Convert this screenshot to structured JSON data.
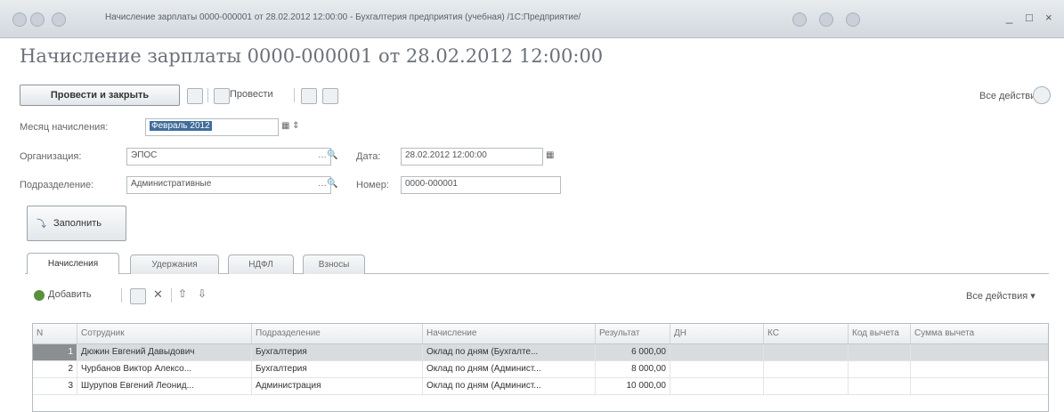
{
  "window": {
    "title": "Начисление зарплаты 0000-000001 от 28.02.2012 12:00:00 - Бухгалтерия предприятия (учебная)   /1С:Предприятие/",
    "controls": [
      "_",
      "□",
      "×"
    ]
  },
  "document": {
    "title": "Начисление зарплаты 0000-000001 от 28.02.2012 12:00:00"
  },
  "toolbar": {
    "post_and_close": "Провести и закрыть",
    "post": "Провести",
    "all_actions": "Все действия ▾"
  },
  "form": {
    "month": {
      "label": "Месяц начисления:",
      "value": "Февраль 2012"
    },
    "organization": {
      "label": "Организация:",
      "value": "ЭПОС"
    },
    "date": {
      "label": "Дата:",
      "value": "28.02.2012 12:00:00"
    },
    "department": {
      "label": "Подразделение:",
      "value": "Административные"
    },
    "number": {
      "label": "Номер:",
      "value": "0000-000001"
    },
    "fill_button": "Заполнить"
  },
  "tabs": [
    "Начисления",
    "Удержания",
    "НДФЛ",
    "Взносы"
  ],
  "table_toolbar": {
    "add": "Добавить",
    "all_actions": "Все действия ▾"
  },
  "table": {
    "headers": [
      "N",
      "Сотрудник",
      "Подразделение",
      "Начисление",
      "Результат",
      "ДН",
      "КС",
      "Код вычета",
      "Сумма вычета"
    ],
    "rows": [
      {
        "n": "1",
        "employee": "Дюжин Евгений Давыдович",
        "department": "Бухгалтерия",
        "accrual": "Оклад по дням (Бухгалте...",
        "result": "6 000,00",
        "dn": "",
        "ks": "",
        "code": "",
        "sum": ""
      },
      {
        "n": "2",
        "employee": "Чурбанов Виктор Алексо...",
        "department": "Бухгалтерия",
        "accrual": "Оклад по дням (Админист...",
        "result": "8 000,00",
        "dn": "",
        "ks": "",
        "code": "",
        "sum": ""
      },
      {
        "n": "3",
        "employee": "Шурупов Евгений Леонид...",
        "department": "Администрация",
        "accrual": "Оклад по дням (Админист...",
        "result": "10 000,00",
        "dn": "",
        "ks": "",
        "code": "",
        "sum": ""
      }
    ]
  }
}
